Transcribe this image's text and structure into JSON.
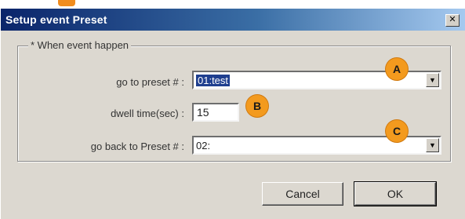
{
  "window": {
    "title": "Setup event Preset",
    "close_glyph": "✕"
  },
  "group": {
    "legend": "* When event happen"
  },
  "fields": {
    "goto_preset": {
      "label": "go to preset # :",
      "value": "01:test"
    },
    "dwell_time": {
      "label": "dwell time(sec) :",
      "value": "15"
    },
    "go_back_preset": {
      "label": "go back to Preset # :",
      "value": "02:"
    }
  },
  "annotations": {
    "a": "A",
    "b": "B",
    "c": "C",
    "color": "#f39a1e"
  },
  "buttons": {
    "cancel": "Cancel",
    "ok": "OK"
  },
  "icons": {
    "dropdown": "chevron-down-icon",
    "close": "close-icon"
  }
}
